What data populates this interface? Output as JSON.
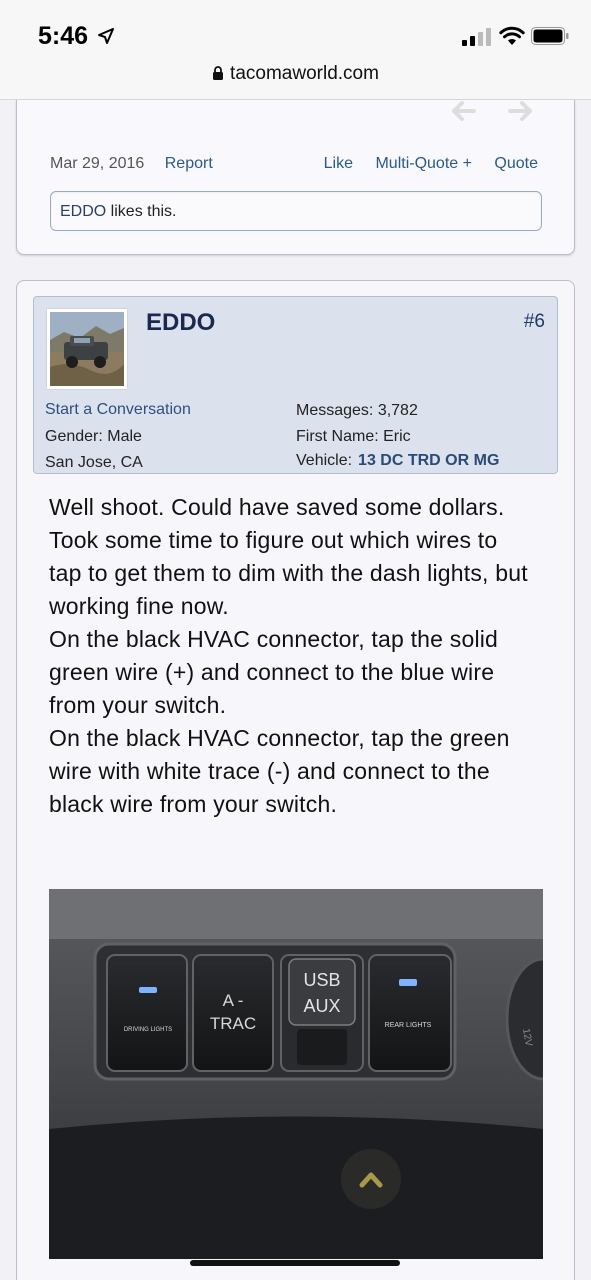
{
  "status_bar": {
    "time": "5:46",
    "url": "tacomaworld.com"
  },
  "previous_post": {
    "date": "Mar 29, 2016",
    "report_label": "Report",
    "like_label": "Like",
    "multiquote_label": "Multi-Quote +",
    "quote_label": "Quote",
    "likes_user": "EDDO",
    "likes_suffix": " likes this."
  },
  "post": {
    "username": "EDDO",
    "post_number": "#6",
    "start_conversation_label": "Start a Conversation",
    "gender": "Gender: Male",
    "location": "San Jose, CA",
    "messages": "Messages: 3,782",
    "first_name": "First Name: Eric",
    "vehicle_label": "Vehicle:",
    "vehicle_value": "13 DC TRD OR MG",
    "body": [
      "Well shoot. Could have saved some dollars. Took some time to figure out which wires to tap to get them to dim with the dash lights, but working fine now.",
      "On the black HVAC connector, tap the solid green wire (+) and connect to the blue wire from your switch.",
      "On the black HVAC connector, tap the green wire with white trace (-) and connect to the black wire from your switch."
    ],
    "photo_labels": {
      "switch1": "DRIVING LIGHTS",
      "switch2_line1": "A -",
      "switch2_line2": "TRAC",
      "usb_line1": "USB",
      "usb_line2": "AUX",
      "switch4": "REAR LIGHTS",
      "side": "12V"
    }
  }
}
